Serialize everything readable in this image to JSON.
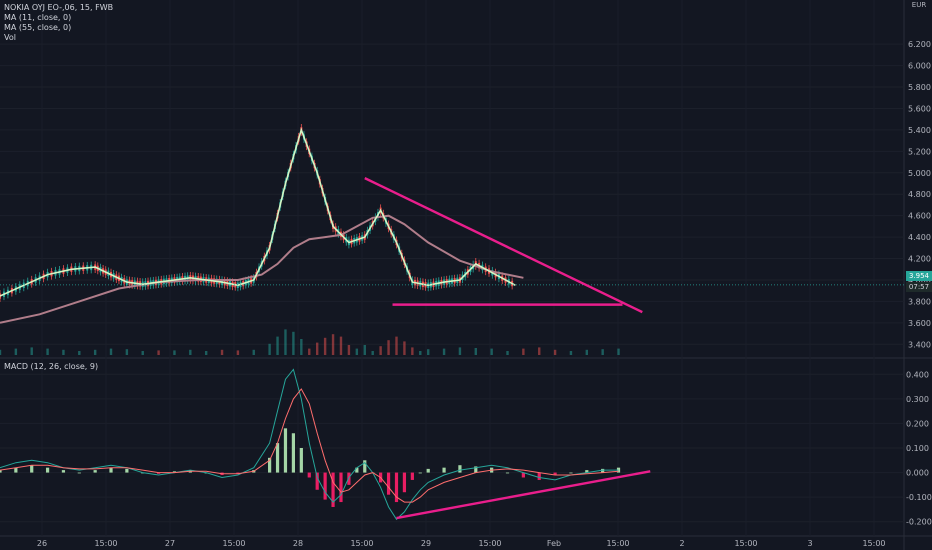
{
  "main_legend": {
    "title": "NOKIA OYJ EO-,06, 15, FWB",
    "ma11": "MA (11, close, 0)",
    "ma55": "MA (55, close, 0)",
    "vol": "Vol"
  },
  "macd_legend": "MACD (12, 26, close, 9)",
  "currency": "EUR",
  "price_tags": {
    "last_price": "3.954",
    "countdown": "07:57"
  },
  "colors": {
    "background": "#131722",
    "up": "#26a69a",
    "down": "#ef5350",
    "ma11": "#d4f5c4",
    "ma55": "#b07d8a",
    "trendline": "#e91e8c",
    "macd_line": "#2196f3",
    "signal_line": "#ff6d6d"
  },
  "chart_data": [
    {
      "type": "line",
      "panel": "price",
      "title": "NOKIA OYJ EO-,06, 15, FWB",
      "ylabel": "EUR",
      "ylim": [
        3.3,
        6.5
      ],
      "y_ticks": [
        "3.400",
        "3.600",
        "3.800",
        "4.000",
        "4.200",
        "4.400",
        "4.600",
        "4.800",
        "5.000",
        "5.200",
        "5.400",
        "5.600",
        "5.800",
        "6.000",
        "6.200"
      ],
      "x_ticks": [
        "26",
        "15:00",
        "27",
        "15:00",
        "28",
        "15:00",
        "29",
        "15:00",
        "Feb",
        "15:00",
        "2",
        "15:00",
        "3",
        "15:00"
      ],
      "series": [
        {
          "name": "MA (11, close, 0)",
          "x": [
            0,
            6,
            12,
            18,
            24,
            28,
            32,
            36,
            40,
            44,
            48,
            52,
            56,
            60,
            64,
            68,
            72,
            76,
            80,
            84,
            88,
            92,
            96,
            100,
            104,
            108,
            112,
            116,
            120,
            125,
            130
          ],
          "y": [
            3.85,
            3.95,
            4.05,
            4.1,
            4.12,
            4.05,
            3.98,
            3.96,
            3.98,
            4.0,
            4.02,
            4.0,
            3.98,
            3.95,
            4.0,
            4.3,
            4.9,
            5.4,
            5.0,
            4.5,
            4.35,
            4.4,
            4.65,
            4.35,
            3.98,
            3.95,
            3.98,
            4.0,
            4.15,
            4.05,
            3.95
          ]
        },
        {
          "name": "MA (55, close, 0)",
          "x": [
            0,
            10,
            20,
            30,
            40,
            50,
            60,
            66,
            70,
            74,
            78,
            82,
            86,
            90,
            94,
            98,
            102,
            108,
            116,
            124,
            132
          ],
          "y": [
            3.6,
            3.68,
            3.8,
            3.92,
            3.98,
            4.0,
            4.0,
            4.05,
            4.15,
            4.3,
            4.38,
            4.4,
            4.42,
            4.5,
            4.58,
            4.6,
            4.52,
            4.35,
            4.18,
            4.08,
            4.02
          ]
        }
      ],
      "annotations": [
        {
          "shape": "trendline",
          "points": [
            [
              92,
              4.95
            ],
            [
              162,
              3.7
            ]
          ]
        },
        {
          "shape": "trendline",
          "points": [
            [
              99,
              3.77
            ],
            [
              157,
              3.77
            ]
          ]
        }
      ]
    },
    {
      "type": "bar",
      "panel": "macd",
      "title": "MACD (12, 26, close, 9)",
      "ylim": [
        -0.25,
        0.45
      ],
      "y_ticks": [
        "0.400",
        "0.300",
        "0.200",
        "0.100",
        "0.000",
        "-0.100",
        "-0.200"
      ],
      "x": [
        0,
        4,
        8,
        12,
        16,
        20,
        24,
        28,
        32,
        36,
        40,
        44,
        48,
        52,
        56,
        60,
        64,
        68,
        70,
        72,
        74,
        76,
        78,
        80,
        82,
        84,
        86,
        88,
        90,
        92,
        94,
        96,
        98,
        100,
        102,
        104,
        106,
        108,
        112,
        116,
        120,
        124,
        128,
        132,
        136,
        140,
        144,
        148,
        152,
        156
      ],
      "series": [
        {
          "name": "histogram",
          "values": [
            0.01,
            0.02,
            0.03,
            0.02,
            0.01,
            0.0,
            0.01,
            0.02,
            0.015,
            0.0,
            -0.005,
            0.005,
            0.01,
            0.0,
            -0.01,
            -0.005,
            0.01,
            0.06,
            0.12,
            0.18,
            0.16,
            0.1,
            -0.02,
            -0.07,
            -0.11,
            -0.14,
            -0.12,
            -0.05,
            0.02,
            0.05,
            0.0,
            -0.04,
            -0.09,
            -0.12,
            -0.08,
            -0.03,
            0.0,
            0.015,
            0.02,
            0.03,
            0.025,
            0.02,
            0.0,
            -0.02,
            -0.03,
            -0.01,
            0.0,
            0.01,
            0.015,
            0.02
          ]
        },
        {
          "name": "macd",
          "values": [
            0.02,
            0.04,
            0.05,
            0.04,
            0.02,
            0.01,
            0.02,
            0.03,
            0.02,
            0.0,
            -0.01,
            0.0,
            0.01,
            0.0,
            -0.02,
            -0.01,
            0.02,
            0.12,
            0.25,
            0.38,
            0.42,
            0.3,
            0.12,
            -0.02,
            -0.08,
            -0.12,
            -0.09,
            -0.02,
            0.02,
            0.04,
            0.0,
            -0.06,
            -0.14,
            -0.19,
            -0.16,
            -0.11,
            -0.07,
            -0.04,
            -0.01,
            0.01,
            0.02,
            0.03,
            0.02,
            0.0,
            -0.02,
            -0.03,
            -0.01,
            0.0,
            0.01,
            0.01
          ]
        },
        {
          "name": "signal",
          "values": [
            0.01,
            0.02,
            0.03,
            0.03,
            0.02,
            0.015,
            0.015,
            0.02,
            0.02,
            0.01,
            0.0,
            0.0,
            0.005,
            0.005,
            -0.005,
            -0.005,
            0.005,
            0.05,
            0.12,
            0.22,
            0.3,
            0.34,
            0.28,
            0.16,
            0.05,
            -0.04,
            -0.08,
            -0.07,
            -0.04,
            -0.01,
            0.0,
            -0.02,
            -0.06,
            -0.1,
            -0.12,
            -0.12,
            -0.1,
            -0.07,
            -0.04,
            -0.02,
            0.0,
            0.01,
            0.015,
            0.01,
            0.0,
            -0.01,
            -0.01,
            -0.005,
            0.0,
            0.005
          ]
        }
      ],
      "annotations": [
        {
          "shape": "trendline",
          "points": [
            [
              100,
              -0.185
            ],
            [
              164,
              0.005
            ]
          ]
        }
      ]
    }
  ]
}
